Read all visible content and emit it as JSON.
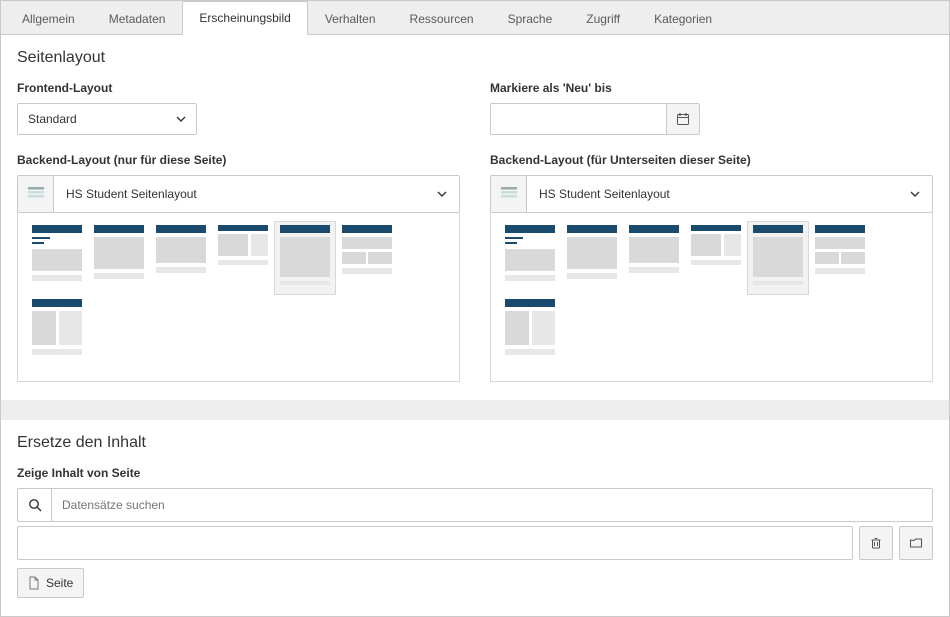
{
  "tabs": [
    {
      "key": "general",
      "label": "Allgemein",
      "active": false
    },
    {
      "key": "meta",
      "label": "Metadaten",
      "active": false
    },
    {
      "key": "appearance",
      "label": "Erscheinungsbild",
      "active": true
    },
    {
      "key": "behaviour",
      "label": "Verhalten",
      "active": false
    },
    {
      "key": "resources",
      "label": "Ressourcen",
      "active": false
    },
    {
      "key": "language",
      "label": "Sprache",
      "active": false
    },
    {
      "key": "access",
      "label": "Zugriff",
      "active": false
    },
    {
      "key": "categories",
      "label": "Kategorien",
      "active": false
    }
  ],
  "section1_title": "Seitenlayout",
  "frontend": {
    "label": "Frontend-Layout",
    "value": "Standard"
  },
  "mark_new": {
    "label": "Markiere als 'Neu' bis",
    "value": ""
  },
  "backend_this": {
    "label": "Backend-Layout (nur für diese Seite)",
    "value": "HS Student Seitenlayout",
    "selected_index": 4
  },
  "backend_sub": {
    "label": "Backend-Layout (für Unterseiten dieser Seite)",
    "value": "HS Student Seitenlayout",
    "selected_index": 4
  },
  "layout_thumbs": [
    "a",
    "b",
    "c",
    "d",
    "e",
    "f",
    "g"
  ],
  "section2_title": "Ersetze den Inhalt",
  "replace": {
    "label": "Zeige Inhalt von Seite",
    "search_placeholder": "Datensätze suchen",
    "page_button": "Seite"
  },
  "colors": {
    "accent": "#1a4b6e"
  }
}
